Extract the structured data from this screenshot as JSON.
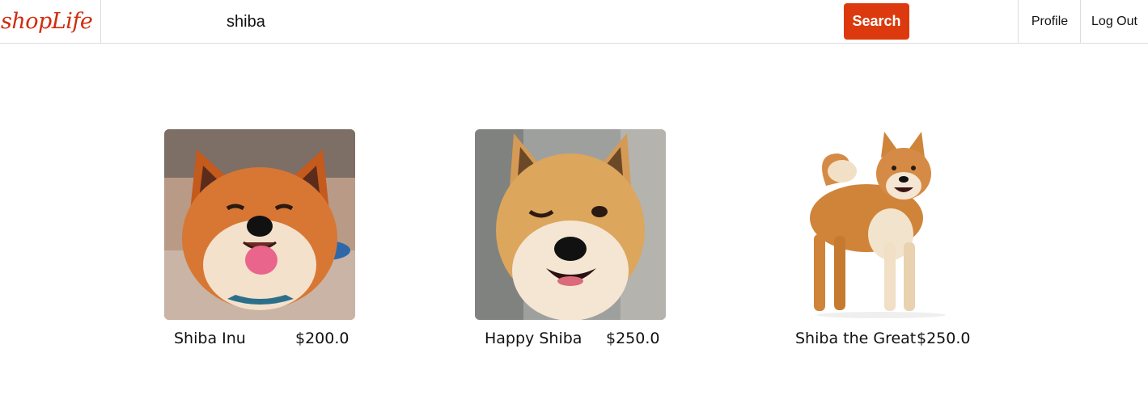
{
  "header": {
    "logo": "shopLife",
    "search": {
      "value": "shiba"
    },
    "search_button": "Search",
    "nav": {
      "profile": "Profile",
      "logout": "Log Out"
    }
  },
  "products": [
    {
      "name": "Shiba Inu",
      "price": "$200.0",
      "image": "shiba-face-tongue"
    },
    {
      "name": "Happy Shiba",
      "price": "$250.0",
      "image": "shiba-face-wink"
    },
    {
      "name": "Shiba the Great",
      "price": "$250.0",
      "image": "shiba-standing"
    }
  ]
}
